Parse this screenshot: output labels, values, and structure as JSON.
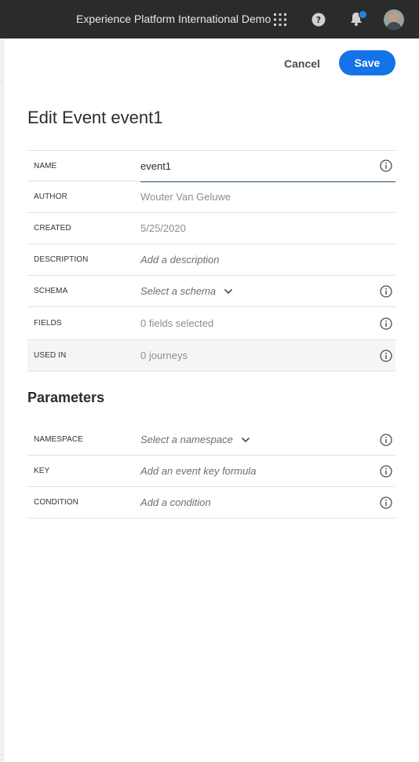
{
  "topbar": {
    "org_name": "Experience Platform International Demo",
    "icons": [
      "apps-grid-icon",
      "help-icon",
      "notifications-bell-icon",
      "user-avatar"
    ],
    "notification_dot_color": "#2680eb"
  },
  "actions": {
    "cancel_label": "Cancel",
    "save_label": "Save",
    "save_color": "#1473e6"
  },
  "page_title": "Edit Event event1",
  "event_fields": {
    "name": {
      "label": "NAME",
      "value": "event1"
    },
    "author": {
      "label": "AUTHOR",
      "value": "Wouter Van Geluwe"
    },
    "created": {
      "label": "CREATED",
      "value": "5/25/2020"
    },
    "description": {
      "label": "DESCRIPTION",
      "placeholder": "Add a description"
    },
    "schema": {
      "label": "SCHEMA",
      "placeholder": "Select a schema"
    },
    "fields": {
      "label": "FIELDS",
      "value": "0 fields selected"
    },
    "used_in": {
      "label": "USED IN",
      "value": "0 journeys"
    }
  },
  "parameters": {
    "title": "Parameters",
    "namespace": {
      "label": "NAMESPACE",
      "placeholder": "Select a namespace"
    },
    "key": {
      "label": "KEY",
      "placeholder": "Add an event key formula"
    },
    "condition": {
      "label": "CONDITION",
      "placeholder": "Add a condition"
    }
  }
}
